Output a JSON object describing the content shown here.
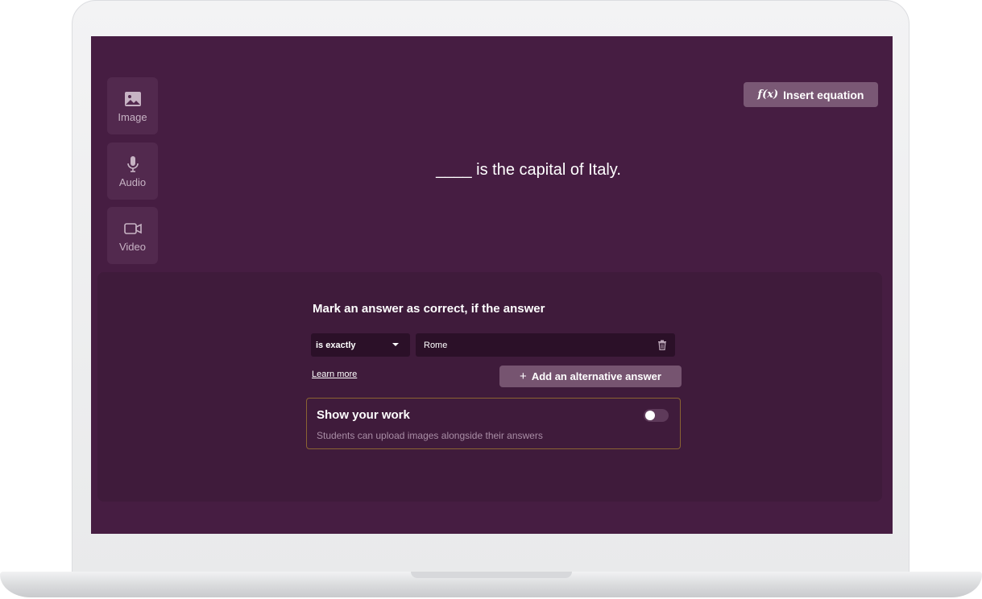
{
  "media_tools": [
    {
      "label": "Image",
      "icon": "image-icon"
    },
    {
      "label": "Audio",
      "icon": "microphone-icon"
    },
    {
      "label": "Video",
      "icon": "video-camera-icon"
    }
  ],
  "toolbar": {
    "equation_icon_text": "f(x)",
    "insert_equation_label": "Insert equation"
  },
  "question": {
    "text": "____ is the capital of Italy."
  },
  "answer_panel": {
    "title": "Mark an answer as correct, if the answer",
    "condition_selected": "is exactly",
    "answer_value": "Rome",
    "learn_more_label": "Learn more",
    "add_alternative_label": "Add an alternative answer",
    "add_alternative_icon": "+"
  },
  "show_your_work": {
    "title": "Show your work",
    "description": "Students can upload images alongside their answers",
    "enabled": false
  },
  "colors": {
    "screen_background": "#461d42",
    "panel_background": "#3f1b3b",
    "button_accent": "#7a5875",
    "card_border": "#8a6432"
  }
}
